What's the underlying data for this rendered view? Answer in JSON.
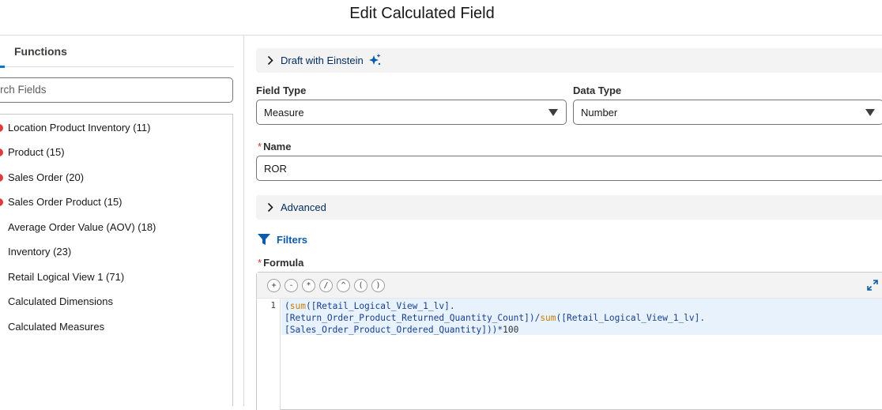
{
  "header": {
    "title": "Edit Calculated Field"
  },
  "left_panel": {
    "tab_label": "Functions",
    "search_placeholder": "Search Fields",
    "tree_items": [
      {
        "label": "Location Product Inventory (11)",
        "marker": true
      },
      {
        "label": "Product (15)",
        "marker": true
      },
      {
        "label": "Sales Order (20)",
        "marker": true
      },
      {
        "label": "Sales Order Product (15)",
        "marker": true
      },
      {
        "label": "Average Order Value (AOV) (18)",
        "marker": false
      },
      {
        "label": "Inventory (23)",
        "marker": false
      },
      {
        "label": "Retail Logical View 1 (71)",
        "marker": false
      },
      {
        "label": "Calculated Dimensions",
        "marker": false
      },
      {
        "label": "Calculated Measures",
        "marker": false
      }
    ]
  },
  "main": {
    "einstein_label": "Draft with Einstein",
    "field_type_label": "Field Type",
    "field_type_value": "Measure",
    "data_type_label": "Data Type",
    "data_type_value": "Number",
    "name_label": "Name",
    "required_marker": "*",
    "name_value": "ROR",
    "advanced_label": "Advanced",
    "filters_label": "Filters",
    "formula_label": "Formula",
    "operators": [
      "+",
      "-",
      "*",
      "/",
      "^",
      "(",
      ")"
    ],
    "line_number": "1",
    "formula": {
      "p1": "(",
      "f1": "sum",
      "p2": "([Retail_Logical_View_1_lv].",
      "p3": "[Return_Order_Product_Returned_Quantity_Count])/",
      "f2": "sum",
      "p4": "([Retail_Logical_View_1_lv].",
      "p5": "[Sales_Order_Product_Ordered_Quantity]))",
      "p6": "*",
      "n1": "100"
    }
  },
  "colors": {
    "accent": "#0176d3",
    "link": "#032d60",
    "required": "#c23934",
    "marker": "#e03b3b"
  }
}
